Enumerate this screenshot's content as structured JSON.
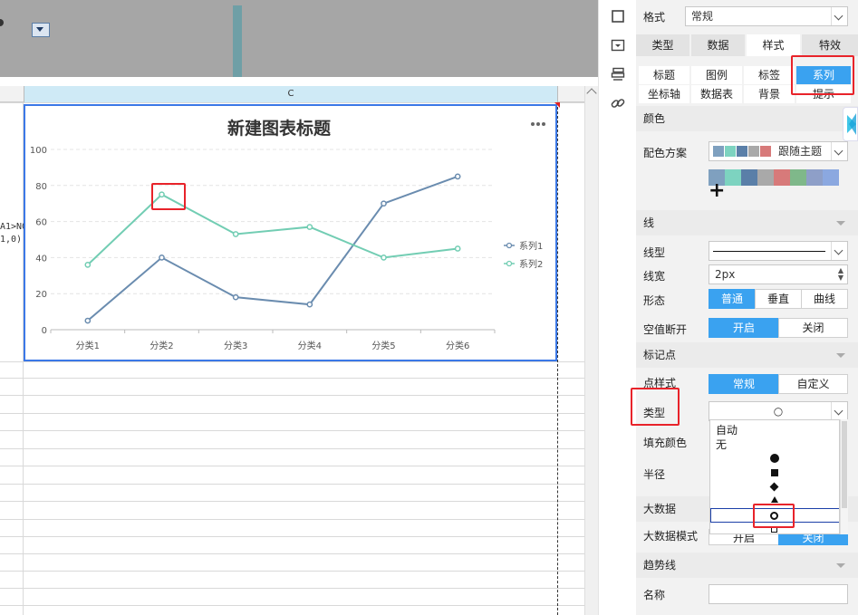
{
  "sheet": {
    "column_c": "C",
    "left_cell_text_1": "A1>NO",
    "left_cell_text_2": "1,0)"
  },
  "chart": {
    "title": "新建图表标题",
    "menu_icon": "more-dots-icon",
    "chart_data": {
      "type": "line",
      "categories": [
        "分类1",
        "分类2",
        "分类3",
        "分类4",
        "分类5",
        "分类6"
      ],
      "series": [
        {
          "name": "系列1",
          "values": [
            5,
            40,
            18,
            14,
            70,
            85
          ],
          "color": "#6a8caf"
        },
        {
          "name": "系列2",
          "values": [
            36,
            75,
            53,
            57,
            40,
            45
          ],
          "color": "#72cdb3"
        }
      ],
      "ylim": [
        0,
        100
      ],
      "yticks": [
        "0",
        "20",
        "40",
        "60",
        "80",
        "100"
      ],
      "grid": true,
      "legend": "right"
    }
  },
  "iconstrip": {
    "icons": [
      "square-icon",
      "dropdown-box-icon",
      "layers-icon",
      "link-icon"
    ]
  },
  "panel": {
    "format_label": "格式",
    "format_value": "常规",
    "tabs": [
      "类型",
      "数据",
      "样式",
      "特效"
    ],
    "subtabs_row1": [
      "标题",
      "图例",
      "标签",
      "系列"
    ],
    "subtabs_row2": [
      "坐标轴",
      "数据表",
      "背景",
      "提示"
    ],
    "color_section": "颜色",
    "color_scheme_label": "配色方案",
    "color_scheme_value": "跟随主题",
    "scheme_colors": [
      "#7fa0bf",
      "#7dd3c0",
      "#5a7fa8",
      "#a9a9a9",
      "#d77a7a"
    ],
    "palette_colors": [
      "#7fa0bf",
      "#7dd3c0",
      "#5a7fa8",
      "#a9a9a9",
      "#d77a7a",
      "#7fb88a",
      "#8e9fc8",
      "#8ba8e0"
    ],
    "add_color": "+",
    "line_section": "线",
    "line_type_label": "线型",
    "line_width_label": "线宽",
    "line_width_value": "2px",
    "shape_label": "形态",
    "shape_options": [
      "普通",
      "垂直",
      "曲线"
    ],
    "null_break_label": "空值断开",
    "null_break_options": [
      "开启",
      "关闭"
    ],
    "marker_section": "标记点",
    "point_style_label": "点样式",
    "point_style_options": [
      "常规",
      "自定义"
    ],
    "type_label": "类型",
    "type_value": "○",
    "fill_color_label": "填充颜色",
    "radius_label": "半径",
    "big_data_section": "大数据",
    "big_data_mode_label": "大数据模式",
    "big_data_options": [
      "开启",
      "关闭"
    ],
    "trend_section": "趋势线",
    "name_label": "名称",
    "type_dropdown_options": [
      "自动",
      "无"
    ]
  }
}
